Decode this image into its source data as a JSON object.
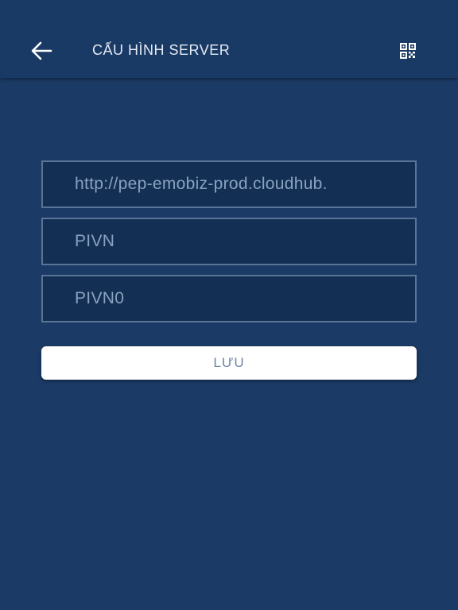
{
  "colors": {
    "background": "#1b3a65",
    "app_bar": "#1a3a66",
    "field_background": "#132f54",
    "field_border": "#5a7497",
    "field_text": "#8aa2c0",
    "button_background": "#ffffff",
    "button_text": "#6f84a3"
  },
  "header": {
    "back_icon": "arrow-left-icon",
    "title": "CẤU HÌNH SERVER",
    "qr_icon": "qr-code-icon"
  },
  "form": {
    "server_url": {
      "value": "http://pep-emobiz-prod.cloudhub."
    },
    "company": {
      "value": "PIVN"
    },
    "username": {
      "value": "PIVN0"
    },
    "save_label": "LƯU"
  }
}
